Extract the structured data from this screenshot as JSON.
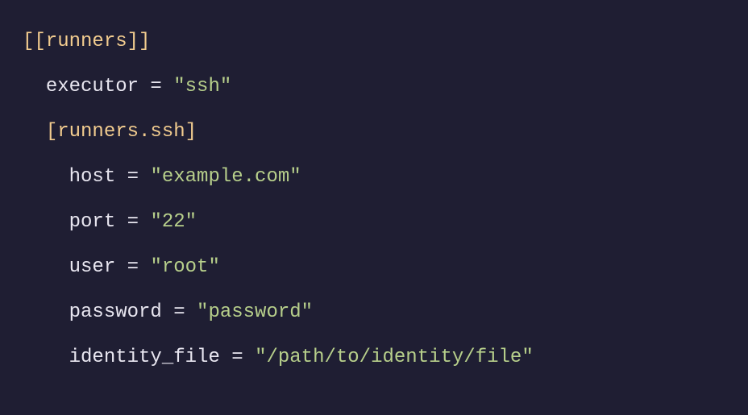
{
  "config": {
    "section_outer": "[[runners]]",
    "kv_executor_key": "executor",
    "kv_executor_val": "\"ssh\"",
    "section_inner": "[runners.ssh]",
    "kv_host_key": "host",
    "kv_host_val": "\"example.com\"",
    "kv_port_key": "port",
    "kv_port_val": "\"22\"",
    "kv_user_key": "user",
    "kv_user_val": "\"root\"",
    "kv_password_key": "password",
    "kv_password_val": "\"password\"",
    "kv_identity_key": "identity_file",
    "kv_identity_val": "\"/path/to/identity/file\"",
    "eq": " = "
  }
}
